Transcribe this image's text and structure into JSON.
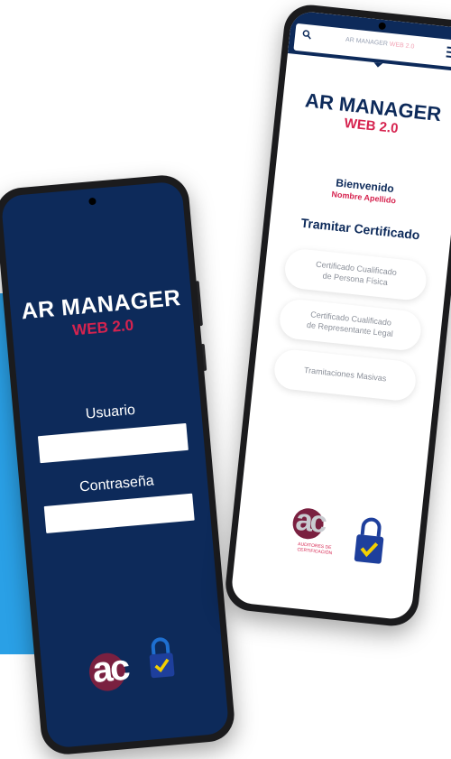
{
  "colors": {
    "navy": "#0d2a5a",
    "brand_red": "#d6234f",
    "accent_blue": "#2aa0e6"
  },
  "login_screen": {
    "title": "AR MANAGER",
    "subtitle": "WEB 2.0",
    "username_label": "Usuario",
    "password_label": "Contraseña",
    "logo_text": "ac"
  },
  "app_screen": {
    "header_title": "AR MANAGER",
    "header_title_highlight": "WEB 2.0",
    "title": "AR MANAGER",
    "subtitle": "WEB 2.0",
    "welcome": "Bienvenido",
    "user_name": "Nombre Apellido",
    "section_title": "Tramitar Certificado",
    "options": [
      {
        "line1": "Certificado Cualificado",
        "line2": "de Persona Física"
      },
      {
        "line1": "Certificado Cualificado",
        "line2": "de Representante Legal"
      },
      {
        "line1": "Tramitaciones Masivas",
        "line2": ""
      }
    ],
    "logo_text": "ac",
    "logo_caption_1": "AUDITORES DE",
    "logo_caption_2": "CERTIFICACIÓN",
    "icons": [
      "search-icon",
      "menu-icon",
      "lock-icon"
    ]
  }
}
